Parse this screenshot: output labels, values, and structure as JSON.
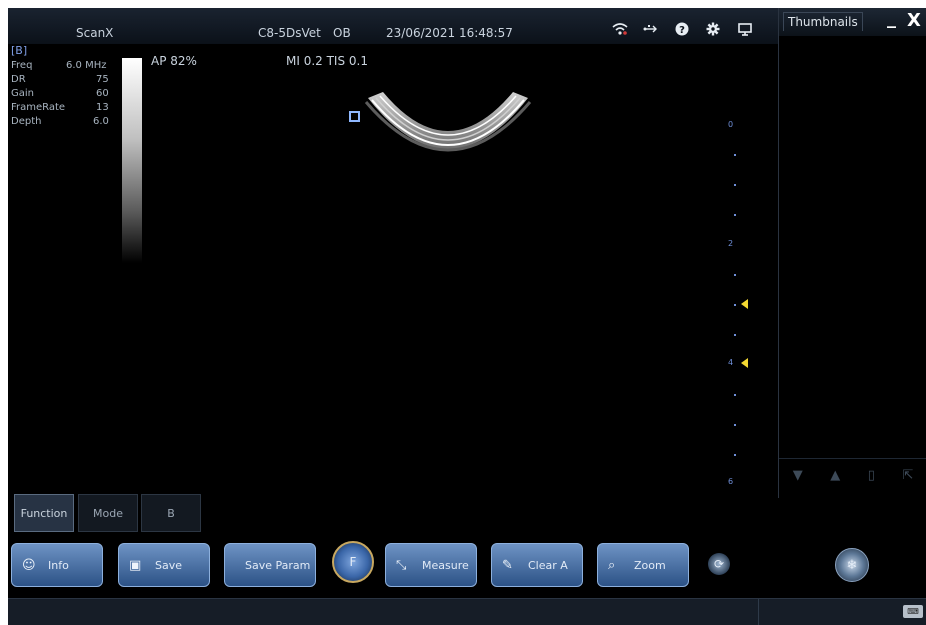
{
  "header": {
    "app_name": "ScanX",
    "probe": "C8-5DsVet",
    "preset": "OB",
    "datetime": "23/06/2021 16:48:57"
  },
  "header_icons": [
    "wifi-icon",
    "usb-icon",
    "help-icon",
    "settings-gear-icon",
    "monitor-icon"
  ],
  "image_params": {
    "mode_label": "[B]",
    "rows": [
      {
        "label": "Freq",
        "value": "6.0 MHz"
      },
      {
        "label": "DR",
        "value": "75"
      },
      {
        "label": "Gain",
        "value": "60"
      },
      {
        "label": "FrameRate",
        "value": "13"
      },
      {
        "label": "Depth",
        "value": "6.0"
      }
    ],
    "ap": "AP 82%",
    "mi_tis": "MI 0.2 TIS 0.1"
  },
  "depth_scale": {
    "labels": [
      "0",
      "2",
      "4",
      "6"
    ],
    "focus_marks_cm": [
      3.2,
      4.0
    ]
  },
  "thumbnails": {
    "title": "Thumbnails",
    "minimize": "_",
    "close": "X",
    "toolbar_icons": [
      "chevron-down-icon",
      "chevron-up-icon",
      "trash-icon",
      "export-icon"
    ]
  },
  "tabs": {
    "function": "Function",
    "mode": "Mode",
    "b": "B"
  },
  "buttons": {
    "info": "Info",
    "save": "Save",
    "save_param": "Save Param",
    "freeze": "F",
    "measure": "Measure",
    "clear_all": "Clear A",
    "zoom": "Zoom"
  },
  "colors": {
    "button_top": "#6e93c4",
    "button_bottom": "#2c5286",
    "depth_scale": "#6f8fd8",
    "focus_marker": "#f3d832"
  }
}
